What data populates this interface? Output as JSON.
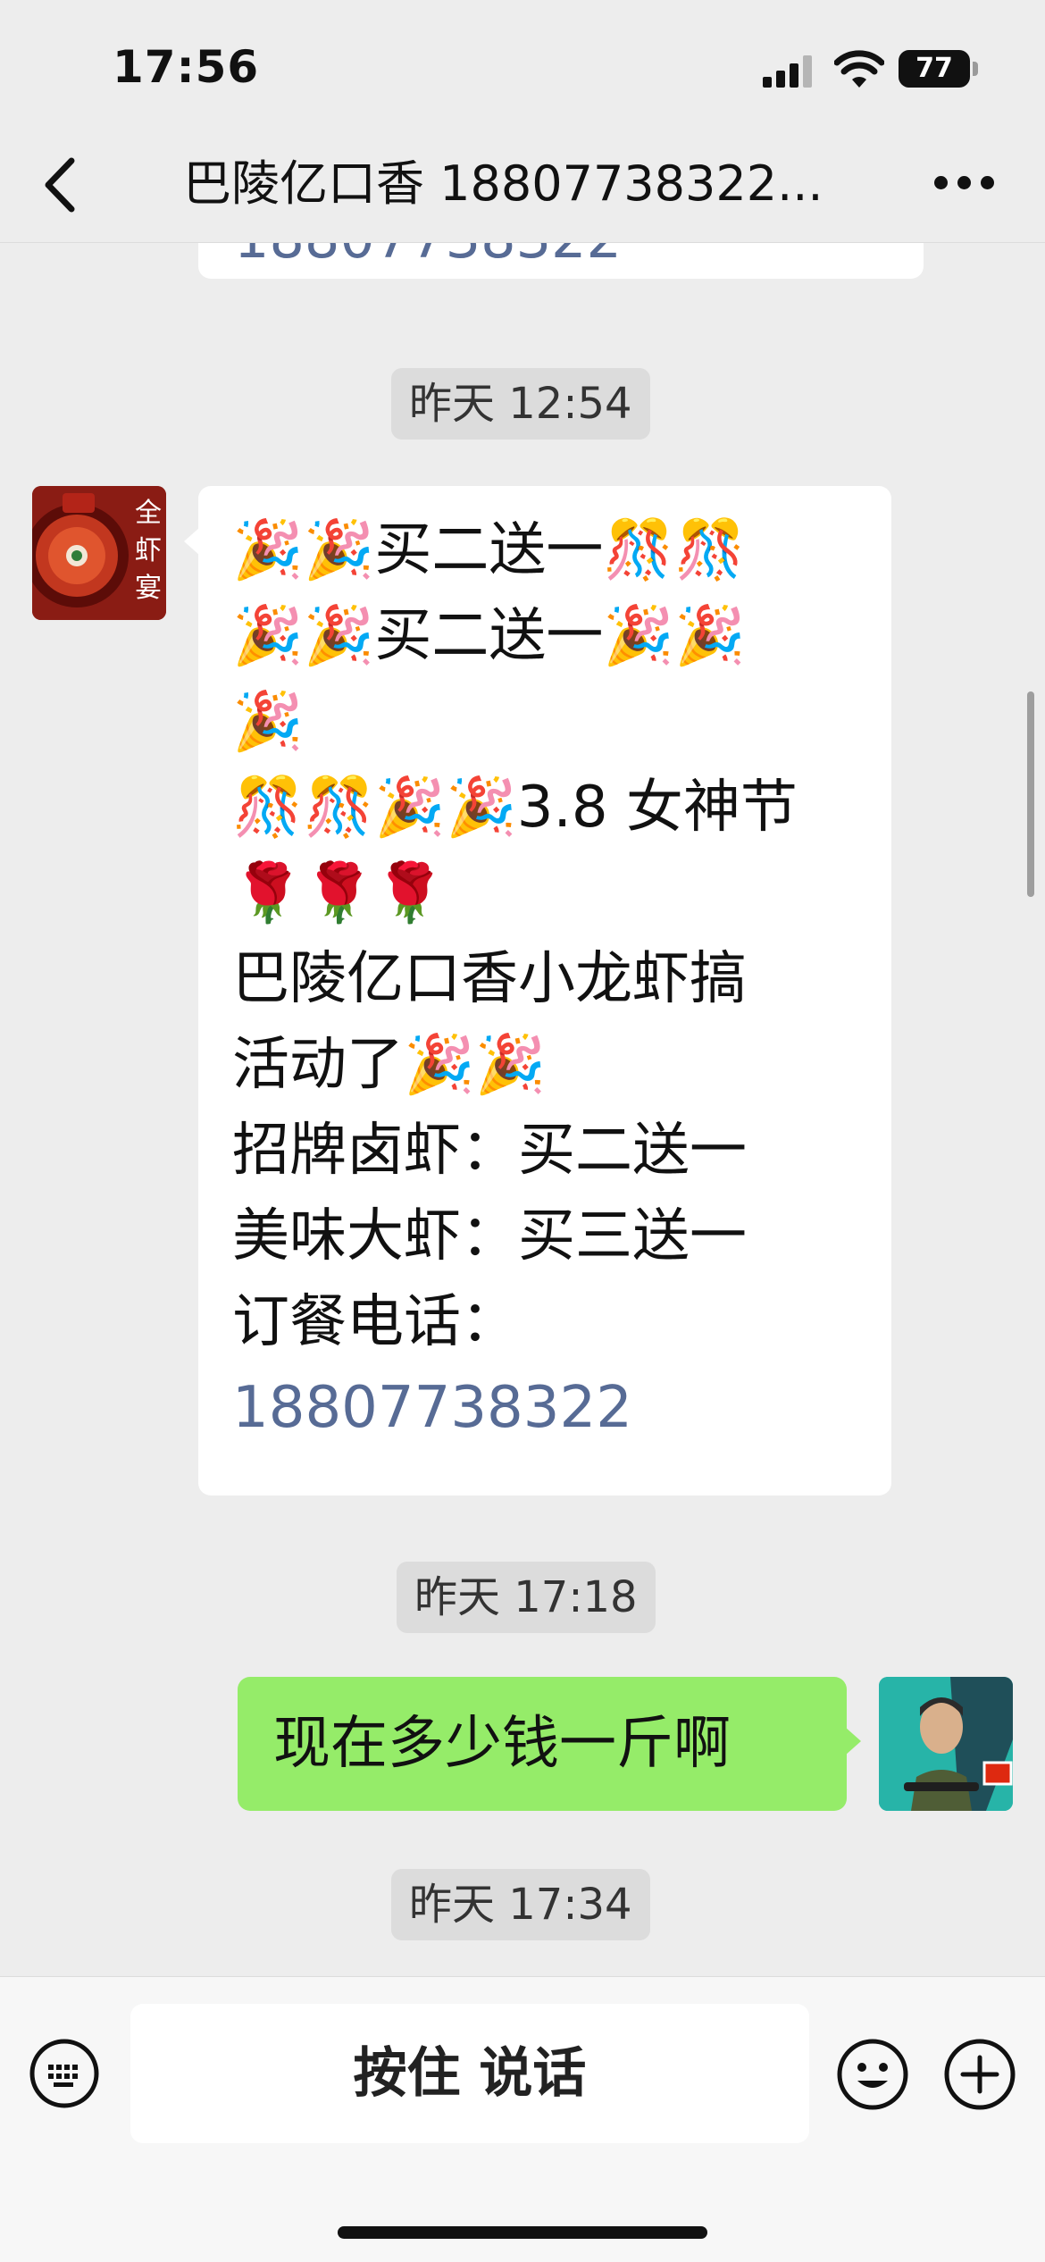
{
  "status_bar": {
    "time": "17:56",
    "battery": "77"
  },
  "nav": {
    "title": "巴陵亿口香 18807738322..."
  },
  "messages": {
    "partial_text": "18807738322",
    "timestamp1": "昨天 12:54",
    "incoming_lines": [
      "🎉🎉买二送一🎊🎊",
      "🎉🎉买二送一🎉🎉",
      "🎉",
      "🎊🎊🎉🎉3.8 女神节",
      "🌹🌹🌹",
      "巴陵亿口香小龙虾搞",
      "活动了🎉🎉",
      "招牌卤虾：买二送一",
      "美味大虾：买三送一",
      "订餐电话："
    ],
    "incoming_phone": "18807738322",
    "avatar_left_label": "全虾宴",
    "timestamp2": "昨天 17:18",
    "outgoing_text": "现在多少钱一斤啊",
    "timestamp3": "昨天 17:34"
  },
  "input_bar": {
    "voice_label": "按住 说话"
  },
  "colors": {
    "background": "#ededed",
    "incoming_bubble": "#ffffff",
    "outgoing_bubble": "#95ec69",
    "link": "#576b95"
  },
  "icons": [
    "back-icon",
    "more-icon",
    "keyboard-icon",
    "emoji-icon",
    "plus-icon",
    "signal-icon",
    "wifi-icon",
    "battery-icon"
  ]
}
